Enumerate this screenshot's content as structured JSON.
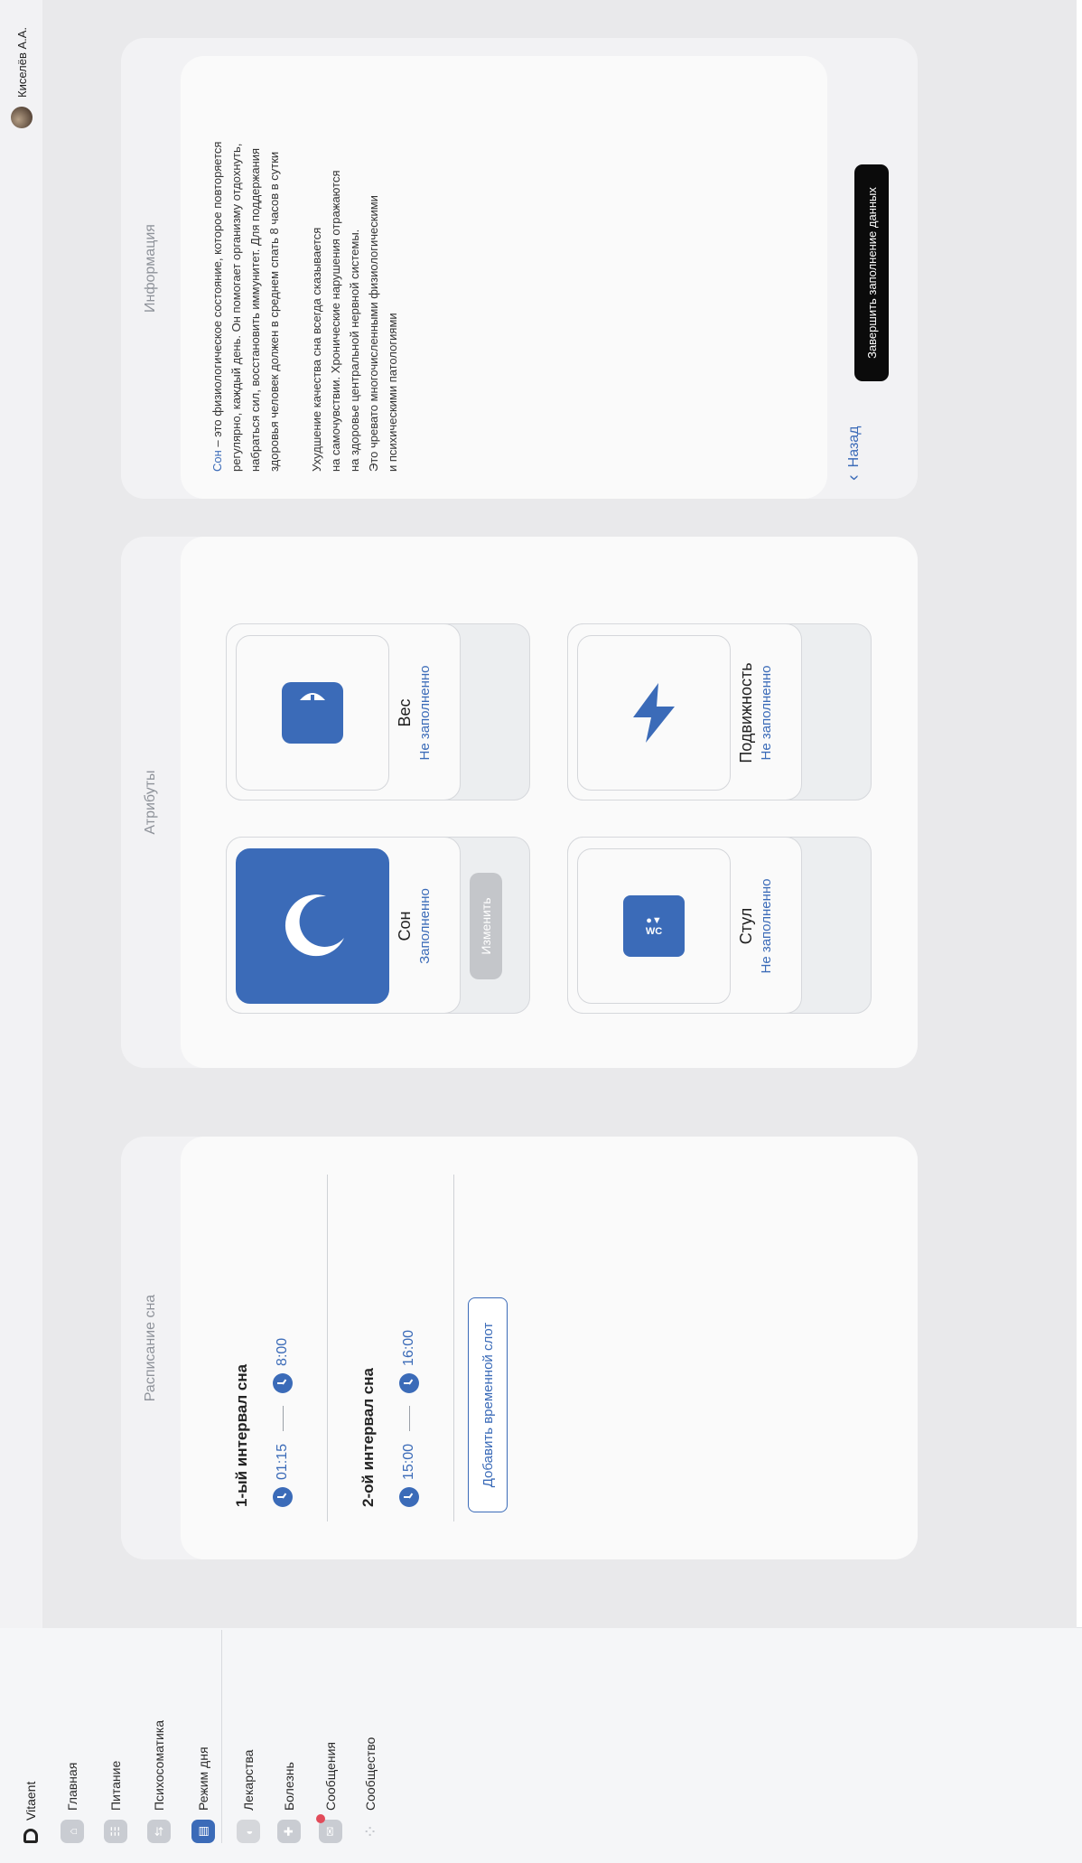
{
  "app": {
    "name": "Vitaent"
  },
  "user": {
    "name": "Киселёв А.А."
  },
  "sidebar": {
    "items": [
      {
        "label": "Главная",
        "icon": "home-icon",
        "active": false
      },
      {
        "label": "Питание",
        "icon": "nutrition-icon",
        "active": false
      },
      {
        "label": "Психосоматика",
        "icon": "psychosomatics-icon",
        "active": false
      },
      {
        "label": "Режим дня",
        "icon": "daily-routine-icon",
        "active": true
      },
      {
        "label": "Лекарства",
        "icon": "pill-icon",
        "active": false
      },
      {
        "label": "Болезнь",
        "icon": "illness-icon",
        "active": false
      },
      {
        "label": "Сообщения",
        "icon": "messages-icon",
        "active": false,
        "badge": true
      },
      {
        "label": "Сообщество",
        "icon": "community-icon",
        "active": false
      }
    ]
  },
  "schedule": {
    "title": "Расписание сна",
    "intervals": [
      {
        "title": "1-ый интервал сна",
        "start": "01:15",
        "end": "8:00"
      },
      {
        "title": "2-ой интервал сна",
        "start": "15:00",
        "end": "16:00"
      }
    ],
    "add_slot_label": "Добавить временной слот"
  },
  "attributes": {
    "title": "Атрибуты",
    "items": [
      {
        "name": "Сон",
        "status": "Заполненно",
        "icon": "moon-icon",
        "edit_label": "Изменить"
      },
      {
        "name": "Вес",
        "status": "Не заполненно",
        "icon": "scale-icon"
      },
      {
        "name": "Стул",
        "status": "Не заполненно",
        "icon": "wc-icon",
        "icon_text": "WC"
      },
      {
        "name": "Подвижность",
        "status": "Не заполненно",
        "icon": "lightning-icon"
      }
    ]
  },
  "info": {
    "title": "Информация",
    "p1": [
      {
        "hl": "Сон",
        "rest": " – это физиологическое состояние,  которое повторяется"
      },
      {
        "rest": "регулярно, каждый день. Он помогает организму отдохнуть,"
      },
      {
        "rest": "набраться сил, восстановить иммунитет. Для поддержания"
      },
      {
        "rest": "здоровья человек должен в среднем спать 8 часов в сутки"
      }
    ],
    "p2": [
      "Ухудшение качества сна всегда сказывается",
      "на самочувствии. Хронические нарушения отражаются",
      "на здоровье центральной нервной системы.",
      "Это чревато многочисленными физиологическими",
      "и психическими патологиями"
    ],
    "back_label": "Назад",
    "finish_label": "Завершить заполнение данных"
  },
  "colors": {
    "accent": "#3b6bb8",
    "badge": "#e24b5a"
  }
}
